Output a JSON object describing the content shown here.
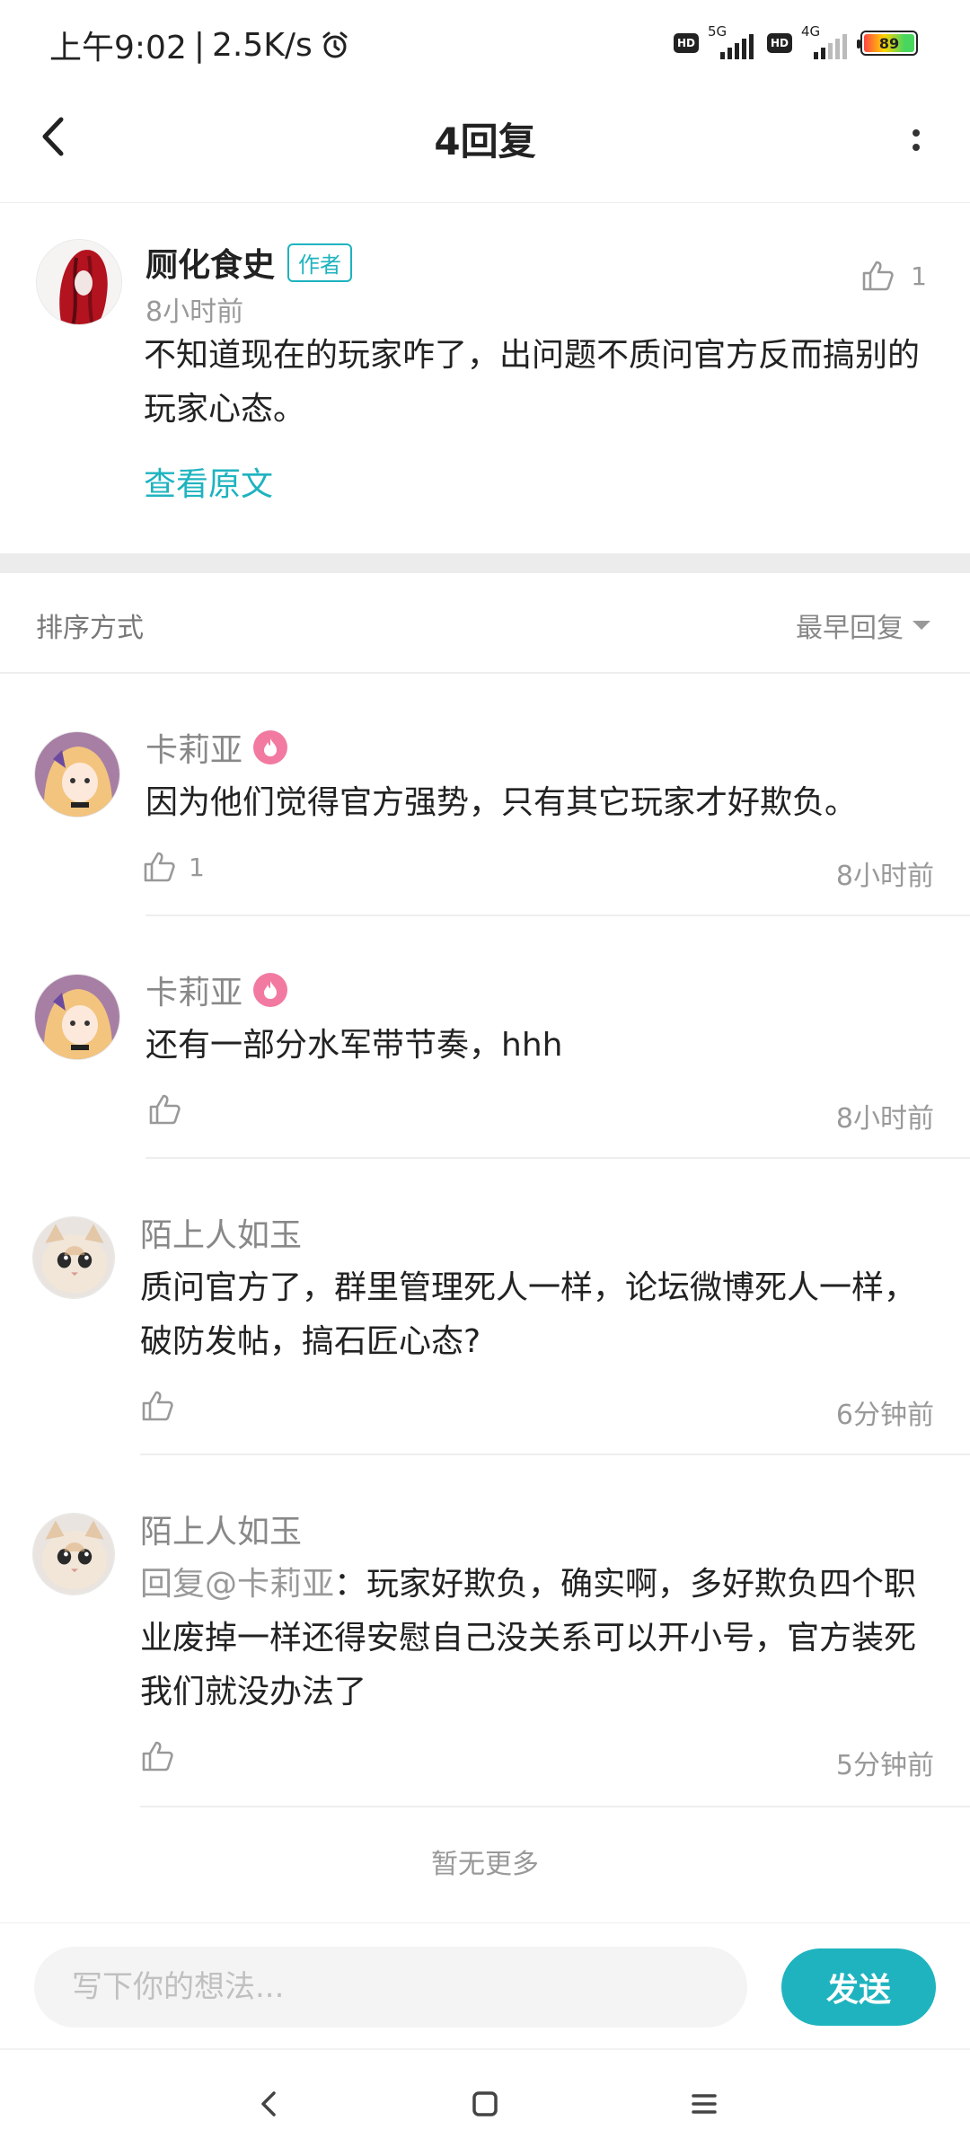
{
  "status_bar": {
    "time": "上午9:02",
    "speed": "2.5K/s",
    "sim1_label": "HD",
    "sim1_network": "5G",
    "sim2_label": "HD",
    "sim2_network": "4G",
    "battery": "89"
  },
  "header": {
    "title": "4回复"
  },
  "original_post": {
    "author": "厕化食史",
    "author_badge": "作者",
    "time": "8小时前",
    "likes": "1",
    "text": "不知道现在的玩家咋了，出问题不质问官方反而搞别的玩家心态。",
    "view_original": "查看原文"
  },
  "sort": {
    "label": "排序方式",
    "selected": "最早回复"
  },
  "replies": [
    {
      "name": "卡莉亚",
      "text": "因为他们觉得官方强势，只有其它玩家才好欺负。",
      "likes": "1",
      "time": "8小时前"
    },
    {
      "name": "卡莉亚",
      "text": "还有一部分水军带节奏，hhh",
      "likes": "",
      "time": "8小时前"
    },
    {
      "name": "陌上人如玉",
      "text": "质问官方了，群里管理死人一样，论坛微博死人一样，破防发帖，搞石匠心态?",
      "likes": "",
      "time": "6分钟前"
    },
    {
      "name": "陌上人如玉",
      "mention": "回复@卡莉亚",
      "text": "：玩家好欺负，确实啊，多好欺负四个职业废掉一样还得安慰自己没关系可以开小号，官方装死我们就没办法了",
      "likes": "",
      "time": "5分钟前"
    }
  ],
  "footer_note": "暂无更多",
  "composer": {
    "placeholder": "写下你的想法...",
    "send_label": "发送"
  },
  "colors": {
    "accent": "#1eb3bf",
    "badge_pink": "#f27aa0"
  }
}
